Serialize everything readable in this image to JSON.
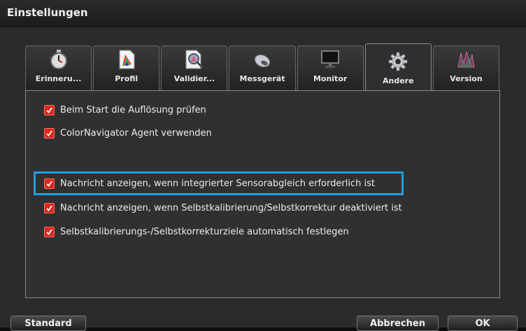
{
  "window": {
    "title": "Einstellungen"
  },
  "tabs": [
    {
      "label": "Erinneru...",
      "icon": "stopwatch-icon"
    },
    {
      "label": "Profil",
      "icon": "profile-document-icon"
    },
    {
      "label": "Validier...",
      "icon": "validation-magnifier-icon"
    },
    {
      "label": "Messgerät",
      "icon": "measuring-device-icon"
    },
    {
      "label": "Monitor",
      "icon": "monitor-icon"
    },
    {
      "label": "Andere",
      "icon": "gear-icon",
      "active": true
    },
    {
      "label": "Version",
      "icon": "version-logo-icon"
    }
  ],
  "options": [
    {
      "label": "Beim Start die Auflösung prüfen",
      "checked": true
    },
    {
      "label": "ColorNavigator Agent verwenden",
      "checked": true
    },
    {
      "label": "Nachricht anzeigen, wenn integrierter Sensorabgleich erforderlich ist",
      "checked": true,
      "highlighted": true
    },
    {
      "label": "Nachricht anzeigen, wenn Selbstkalibrierung/Selbstkorrektur deaktiviert ist",
      "checked": true
    },
    {
      "label": "Selbstkalibrierungs-/Selbstkorrekturziele automatisch festlegen",
      "checked": true
    }
  ],
  "buttons": {
    "standard": "Standard",
    "cancel": "Abbrechen",
    "ok": "OK"
  },
  "colors": {
    "checkbox": "#d62a20",
    "highlight": "#1f9ee0",
    "background": "#2b2b2b"
  }
}
